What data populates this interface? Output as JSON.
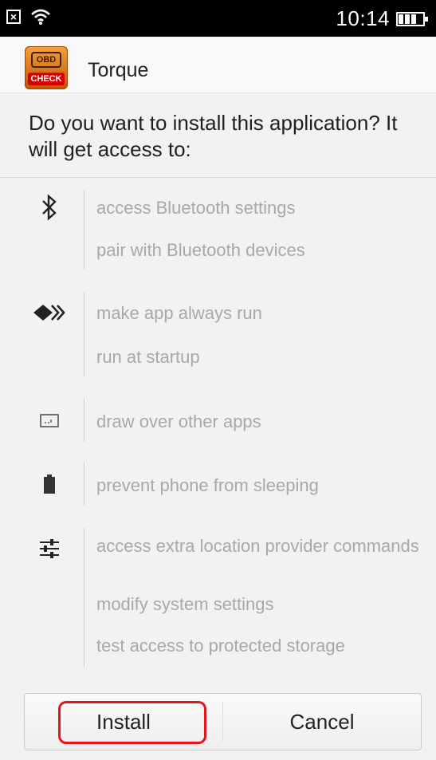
{
  "status_bar": {
    "time": "10:14",
    "notification_icon": "x-box-icon",
    "wifi_icon": "wifi-icon",
    "battery_icon": "battery-icon"
  },
  "app": {
    "icon": "obd-check-icon",
    "icon_text_top": "OBD",
    "icon_text_bottom": "CHECK",
    "name": "Torque"
  },
  "prompt": {
    "question": "Do you want to install this application? It will get access to:"
  },
  "permissions": [
    {
      "icon": "bluetooth-icon",
      "items": [
        "access Bluetooth settings",
        "pair with Bluetooth devices"
      ]
    },
    {
      "icon": "run-arrows-icon",
      "items": [
        "make app always run",
        "run at startup"
      ]
    },
    {
      "icon": "overlay-window-icon",
      "items": [
        "draw over other apps"
      ]
    },
    {
      "icon": "battery-sleep-icon",
      "items": [
        "prevent phone from sleeping"
      ]
    },
    {
      "icon": "settings-sliders-icon",
      "items": [
        "access extra location provider commands",
        "modify system settings",
        "test access to protected storage"
      ]
    }
  ],
  "buttons": {
    "install": "Install",
    "cancel": "Cancel"
  },
  "colors": {
    "highlight": "#e8141c",
    "permission_text": "#a8a8a8"
  }
}
